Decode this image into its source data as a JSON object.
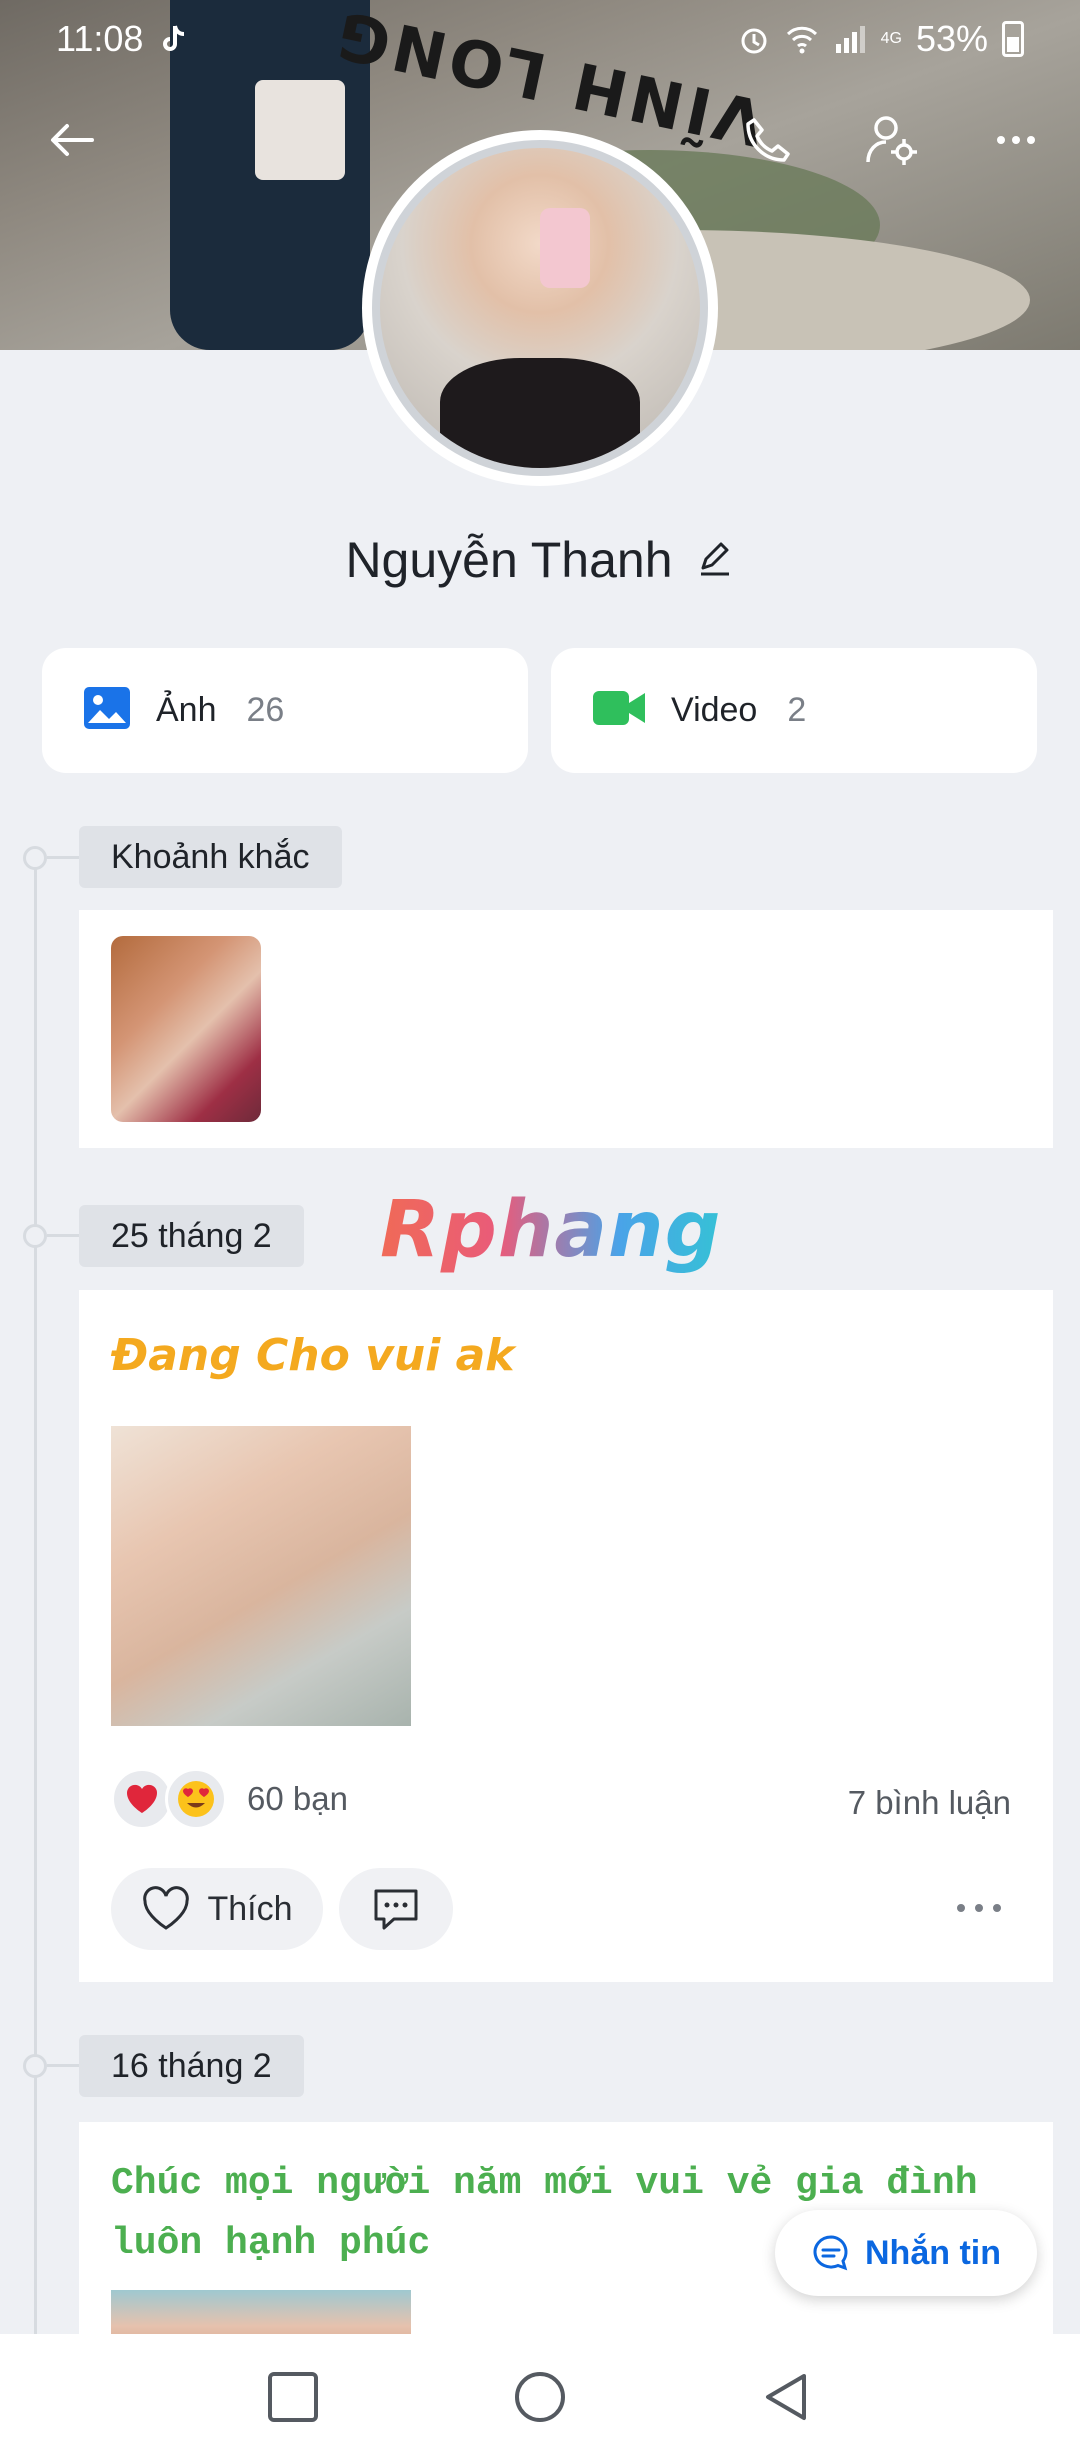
{
  "status_bar": {
    "time": "11:08",
    "network": "4G",
    "battery": "53%"
  },
  "profile": {
    "name": "Nguyễn Thanh"
  },
  "cover": {
    "sign_text": "VĨNH LONG"
  },
  "media": [
    {
      "label": "Ảnh",
      "count": "26",
      "icon": "photo-icon",
      "color": "#1a73e8"
    },
    {
      "label": "Video",
      "count": "2",
      "icon": "video-camera-icon",
      "color": "#2fbf5c"
    }
  ],
  "timeline": {
    "moments_label": "Khoảnh khắc",
    "posts": [
      {
        "date": "25 tháng 2",
        "text": "Đang Cho vui ak",
        "text_color": "#f4a91f",
        "reactions_count": "60 bạn",
        "comments_count": "7 bình luận",
        "like_label": "Thích"
      },
      {
        "date": "16 tháng 2",
        "text": "Chúc mọi người năm mới vui vẻ gia đình luôn hạnh phúc",
        "text_color": "#4caf50"
      }
    ]
  },
  "watermark": "Rphang",
  "chat_button": {
    "label": "Nhắn tin"
  }
}
